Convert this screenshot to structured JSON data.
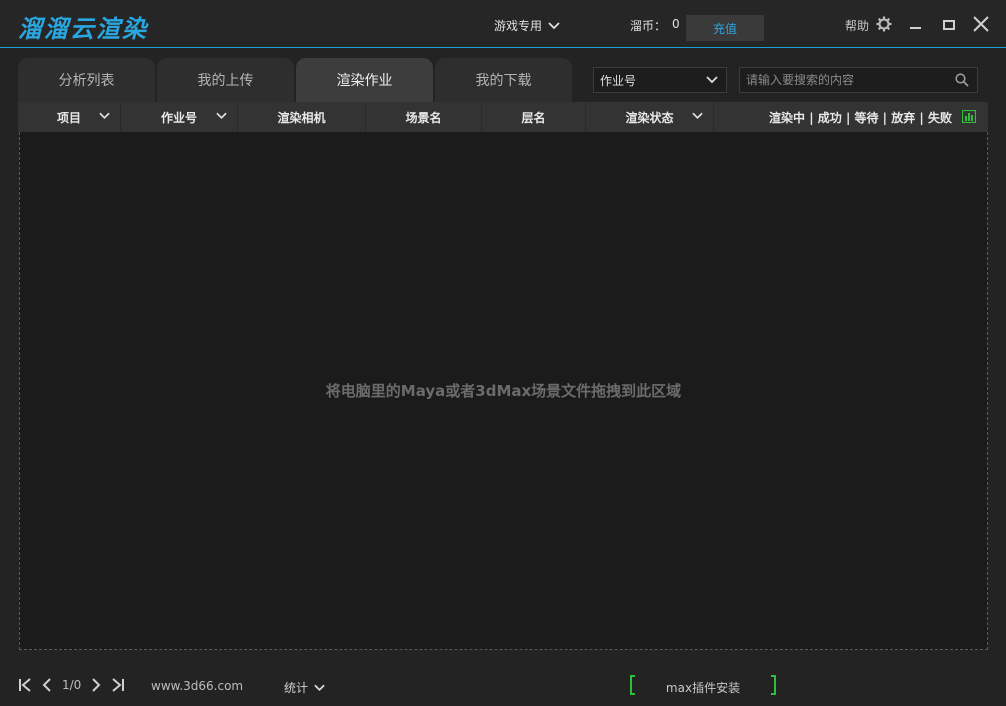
{
  "app": {
    "title": "溜溜云渲染",
    "accent_color": "#2aa7e0",
    "green_color": "#2fbf3a"
  },
  "titlebar": {
    "mode_select": "游戏专用",
    "coin_label": "溜币：",
    "coin_value": "0",
    "recharge_label": "充值",
    "help_label": "帮助",
    "icons": [
      "gear-icon",
      "minimize-icon",
      "maximize-icon",
      "close-icon"
    ]
  },
  "tabs": [
    {
      "label": "分析列表",
      "active": false
    },
    {
      "label": "我的上传",
      "active": false
    },
    {
      "label": "渲染作业",
      "active": true
    },
    {
      "label": "我的下载",
      "active": false
    }
  ],
  "filter": {
    "field_select": "作业号",
    "search_placeholder": "请输入要搜索的内容"
  },
  "table": {
    "columns": [
      {
        "label": "项目",
        "dropdown": true
      },
      {
        "label": "作业号",
        "dropdown": true
      },
      {
        "label": "渲染相机",
        "dropdown": false
      },
      {
        "label": "场景名",
        "dropdown": false
      },
      {
        "label": "层名",
        "dropdown": false
      },
      {
        "label": "渲染状态",
        "dropdown": true
      },
      {
        "label": "渲染中 | 成功 | 等待 | 放弃 | 失败",
        "dropdown": false
      }
    ],
    "rows": []
  },
  "dropzone": {
    "hint": "将电脑里的Maya或者3dMax场景文件拖拽到此区域"
  },
  "footer": {
    "page_info": "1/0",
    "site": "www.3d66.com",
    "stats_label": "统计",
    "plugin_label": "max插件安装"
  }
}
